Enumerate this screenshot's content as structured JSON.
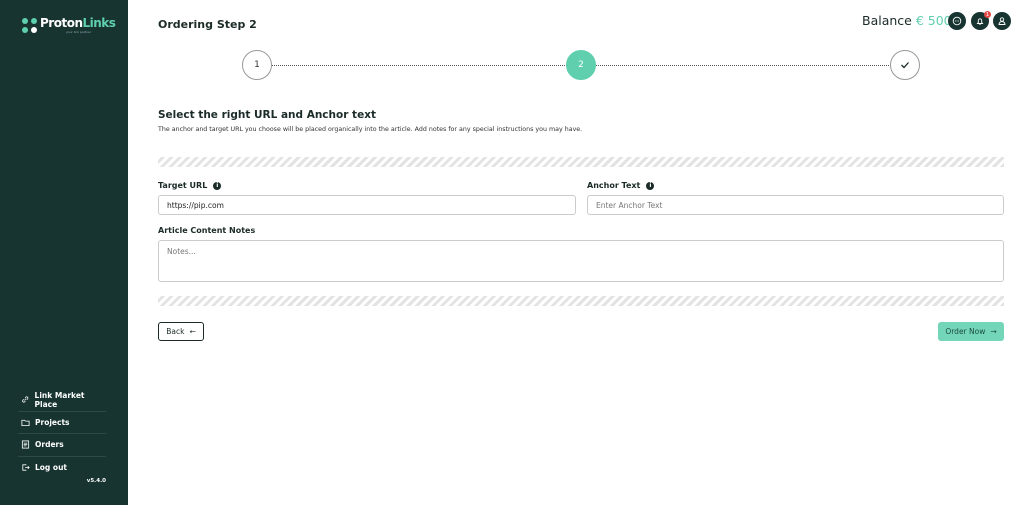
{
  "app": {
    "brand_prefix": "Proton",
    "brand_suffix": "Links",
    "tagline": "your link partner",
    "version": "v5.4.0"
  },
  "sidebar": {
    "items": [
      {
        "label": "Link Market Place",
        "icon": "link-icon"
      },
      {
        "label": "Projects",
        "icon": "folder-icon"
      },
      {
        "label": "Orders",
        "icon": "orders-icon"
      },
      {
        "label": "Log out",
        "icon": "logout-icon"
      }
    ]
  },
  "header": {
    "title": "Ordering Step 2",
    "balance_label": "Balance",
    "balance_amount": "€ 500",
    "notification_count": "1",
    "icons": [
      "chat-icon",
      "bell-icon",
      "user-icon"
    ]
  },
  "steps": {
    "items": [
      "1",
      "2",
      "✓"
    ],
    "active_index": 1
  },
  "form": {
    "title": "Select the right URL and Anchor text",
    "description": "The anchor and target URL you choose will be placed organically into the article. Add notes for any special instructions you may have.",
    "target_url_label": "Target URL",
    "target_url_value": "https://pip.com",
    "anchor_label": "Anchor Text",
    "anchor_placeholder": "Enter Anchor Text",
    "notes_label": "Article Content Notes",
    "notes_placeholder": "Notes..."
  },
  "actions": {
    "back_label": "Back",
    "order_label": "Order Now"
  },
  "colors": {
    "sidebar": "#173430",
    "accent": "#5fcfae",
    "order_button": "#73d6b8"
  }
}
